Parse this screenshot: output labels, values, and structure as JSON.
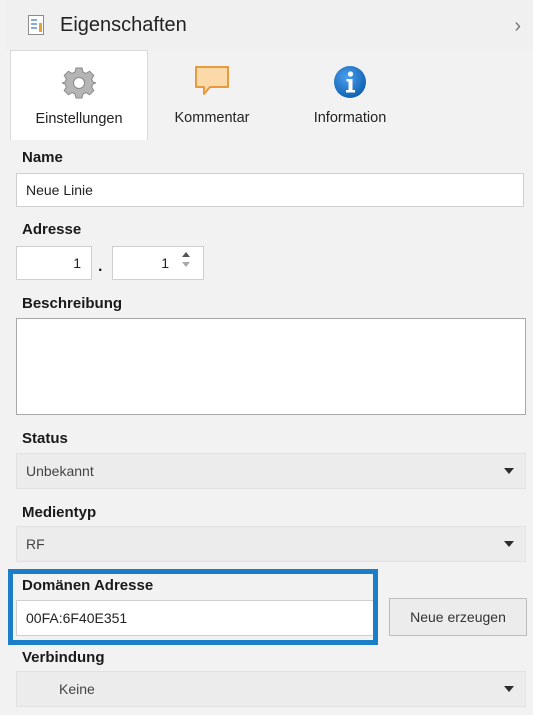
{
  "header": {
    "title": "Eigenschaften",
    "chevron": "›"
  },
  "tabs": [
    {
      "label": "Einstellungen",
      "icon": "gear-icon",
      "active": true
    },
    {
      "label": "Kommentar",
      "icon": "comment-icon",
      "active": false
    },
    {
      "label": "Information",
      "icon": "info-icon",
      "active": false
    }
  ],
  "fields": {
    "name": {
      "label": "Name",
      "value": "Neue Linie"
    },
    "adresse": {
      "label": "Adresse",
      "area": "1",
      "separator": ".",
      "line": "1"
    },
    "beschreibung": {
      "label": "Beschreibung",
      "value": ""
    },
    "status": {
      "label": "Status",
      "value": "Unbekannt"
    },
    "medientyp": {
      "label": "Medientyp",
      "value": "RF"
    },
    "domaenen": {
      "label": "Domänen Adresse",
      "value": "00FA:6F40E351",
      "button": "Neue erzeugen"
    },
    "verbindung": {
      "label": "Verbindung",
      "value": "Keine"
    }
  },
  "colors": {
    "highlight": "#1a7fc8",
    "info_blue": "#1877c9",
    "comment_fill": "#fbd9a8",
    "comment_stroke": "#e89a3c"
  }
}
